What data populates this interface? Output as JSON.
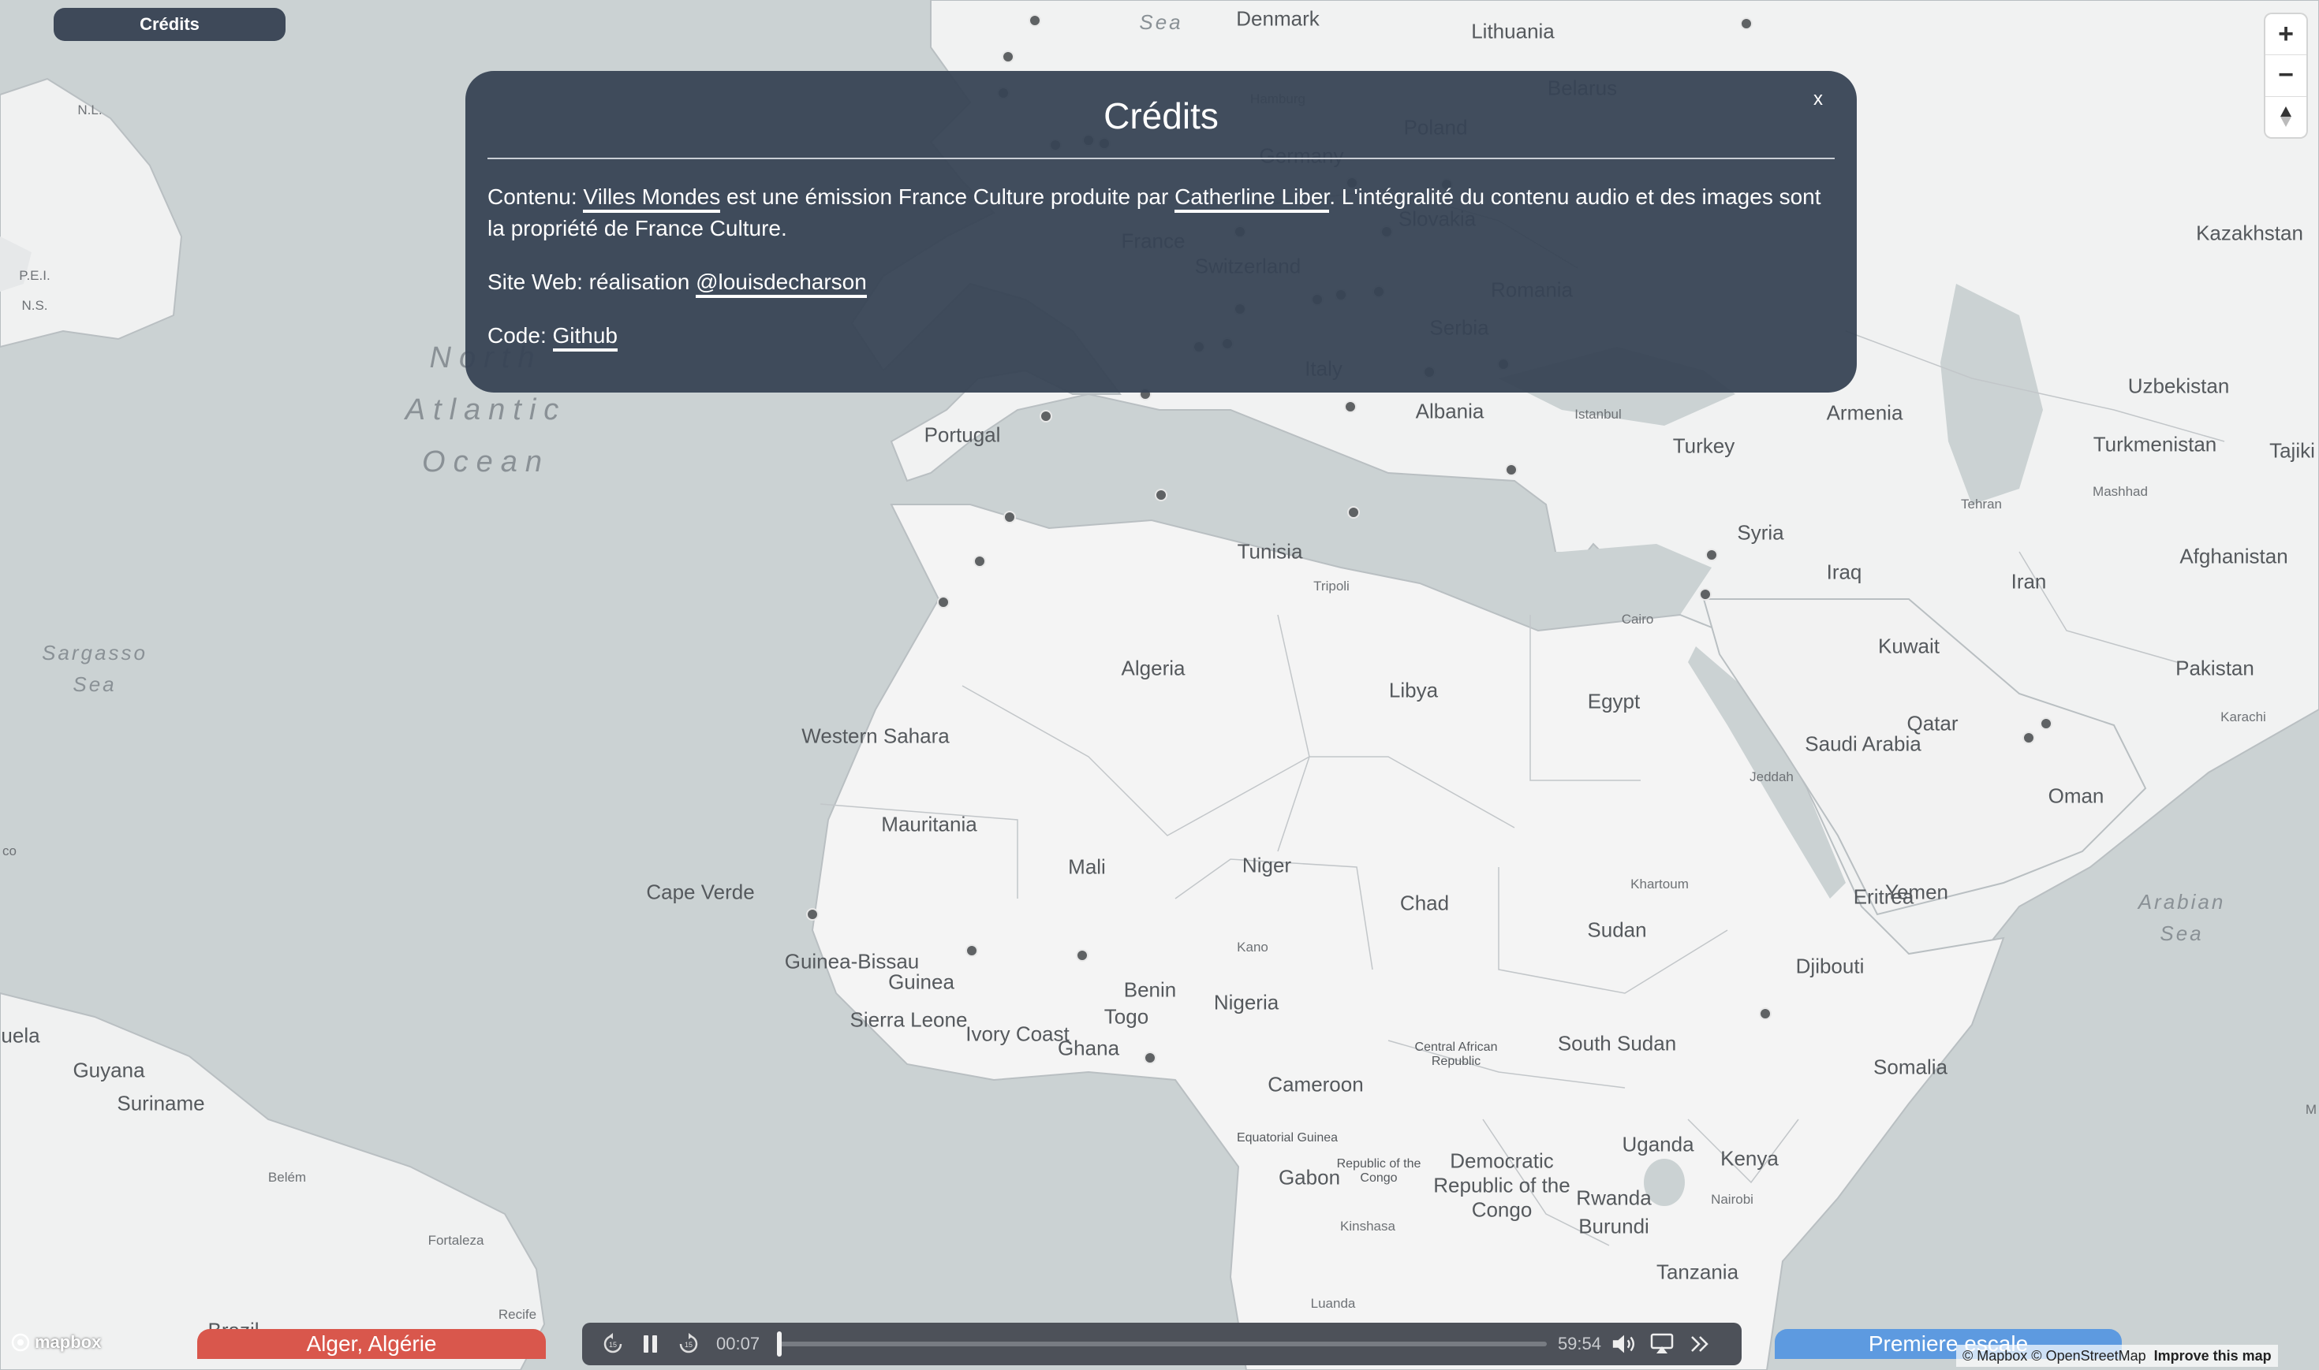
{
  "credits_button": {
    "label": "Crédits"
  },
  "modal": {
    "title": "Crédits",
    "close_label": "x",
    "content_prefix": "Contenu: ",
    "content_link1": "Villes Mondes",
    "content_mid": " est une émission France Culture produite par ",
    "content_link2": "Catherline Liber",
    "content_suffix": ". L'intégralité du contenu audio et des images sont la propriété de France Culture.",
    "site_prefix": "Site Web: réalisation ",
    "site_link": "@louisdecharson",
    "code_prefix": "Code: ",
    "code_link": "Github"
  },
  "zoom": {
    "zoom_in": "+",
    "zoom_out": "−",
    "compass": "▲"
  },
  "map_labels": {
    "countries": [
      "Denmark",
      "Lithuania",
      "Belarus",
      "Poland",
      "Germany",
      "France",
      "Romania",
      "Italy",
      "Albania",
      "Turkey",
      "Kazakhstan",
      "Uzbekistan",
      "Turkmenistan",
      "Tajiki",
      "Armenia",
      "Syria",
      "Iraq",
      "Iran",
      "Afghanistan",
      "Pakistan",
      "Tunisia",
      "Algeria",
      "Libya",
      "Egypt",
      "Saudi Arabia",
      "Oman",
      "Qatar",
      "Kuwait",
      "Western Sahara",
      "Mauritania",
      "Mali",
      "Niger",
      "Chad",
      "Sudan",
      "Yemen",
      "Eritrea",
      "Djibouti",
      "Somalia",
      "South Sudan",
      "Nigeria",
      "Benin",
      "Togo",
      "Ghana",
      "Ivory Coast",
      "Guinea",
      "Guinea-Bissau",
      "Sierra Leone",
      "Cameroon",
      "Central African Republic",
      "Equatorial Guinea",
      "Gabon",
      "Republic of the Congo",
      "Democratic Republic of the Congo",
      "Uganda",
      "Kenya",
      "Rwanda",
      "Burundi",
      "Tanzania",
      "Cape Verde",
      "Portugal",
      "Guyana",
      "Suriname",
      "uela",
      "Brazil",
      "Switzerland",
      "Serbia",
      "Slovakia"
    ],
    "cities": [
      "Hamburg",
      "Istanbul",
      "Tripoli",
      "Cairo",
      "Tehran",
      "Mashhad",
      "Karachi",
      "Jeddah",
      "Khartoum",
      "Kano",
      "Nairobi",
      "Kinshasa",
      "Luanda",
      "Belém",
      "Fortaleza",
      "Recife"
    ],
    "waters": [
      "North\nAtlantic\nOcean",
      "Sargasso\nSea",
      "Arabian\nSea",
      "Sea"
    ],
    "misc": [
      "N.L.",
      "P.E.I.",
      "N.S.",
      "co",
      "M"
    ]
  },
  "player": {
    "current_time": "00:07",
    "total_time": "59:54",
    "progress": 0.002,
    "rewind_icon": "rewind-15-icon",
    "pause_icon": "pause-icon",
    "forward_icon": "forward-15-icon",
    "volume_icon": "volume-icon",
    "airplay_icon": "airplay-icon",
    "next_icon": "double-chevron-right-icon"
  },
  "current_city": "Alger, Algérie",
  "next_button": "Premiere escale",
  "mapbox_logo": "mapbox",
  "attribution": {
    "copy": "© Mapbox © OpenStreetMap",
    "improve": "Improve this map"
  },
  "colors": {
    "water": "#cbd2d3",
    "land": "#f2f2f2",
    "modal": "#374354",
    "city_pill": "#d9574c",
    "next_pill": "#5d9ae0",
    "player": "#4d5159",
    "marker": "#5f6264"
  }
}
